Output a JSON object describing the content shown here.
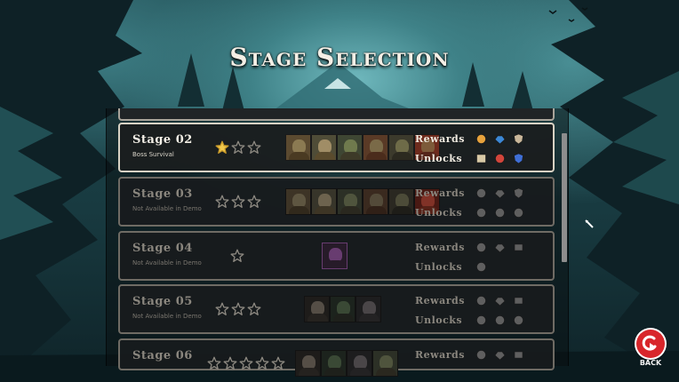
{
  "title": "Stage Selection",
  "labels": {
    "rewards": "Rewards",
    "unlocks": "Unlocks"
  },
  "stages": [
    {
      "name": "Stage 02",
      "subtitle": "Boss Survival",
      "stars_earned": 1,
      "stars_total": 3,
      "available": true,
      "enemies": [
        "brute-portrait",
        "ogre-portrait",
        "orc-portrait",
        "orc-warrior-portrait",
        "goblin-portrait",
        "orc-chief-portrait"
      ],
      "rewards": [
        "gold-orb-icon",
        "rainbow-gem-icon",
        "shield-icon"
      ],
      "unlocks": [
        "book-icon",
        "potion-icon",
        "blue-armor-icon"
      ]
    },
    {
      "name": "Stage 03",
      "subtitle": "Not Available in Demo",
      "stars_earned": 0,
      "stars_total": 3,
      "available": false,
      "enemies": [
        "brute-portrait",
        "ogre-portrait",
        "orc-portrait",
        "orc-warrior-portrait",
        "goblin-portrait",
        "fire-spirit-portrait"
      ],
      "rewards": [
        "orb-icon",
        "gem-cluster-icon",
        "shield-icon"
      ],
      "unlocks": [
        "bolt-icon",
        "hand-icon",
        "flask-icon"
      ]
    },
    {
      "name": "Stage 04",
      "subtitle": "Not Available in Demo",
      "stars_earned": 0,
      "stars_total": 1,
      "available": false,
      "enemies": [
        "mystery-portrait"
      ],
      "rewards": [
        "orb-icon",
        "gem-cluster-icon",
        "scroll-icon"
      ],
      "unlocks": [
        "skull-icon"
      ]
    },
    {
      "name": "Stage 05",
      "subtitle": "Not Available in Demo",
      "stars_earned": 0,
      "stars_total": 3,
      "available": false,
      "enemies": [
        "skeleton-portrait",
        "ghoul-portrait",
        "zombie-portrait"
      ],
      "rewards": [
        "orb-icon",
        "gem-cluster-icon",
        "scroll-icon"
      ],
      "unlocks": [
        "gear-icon",
        "door-icon",
        "ring-icon"
      ]
    },
    {
      "name": "Stage 06",
      "subtitle": "",
      "stars_earned": 0,
      "stars_total": 5,
      "available": false,
      "enemies": [
        "skeleton-portrait",
        "ghoul-portrait",
        "zombie-portrait",
        "orc-portrait"
      ],
      "rewards": [
        "orb-icon",
        "gem-cluster-icon",
        "scroll-icon"
      ],
      "unlocks": []
    }
  ],
  "back_button": {
    "label": "BACK",
    "icon": "back-arrow-icon"
  },
  "colors": {
    "accent": "#d8262b",
    "star_gold": "#f2c94c",
    "frame_active": "#d8d2c4",
    "frame_inactive": "#6f6b64"
  }
}
